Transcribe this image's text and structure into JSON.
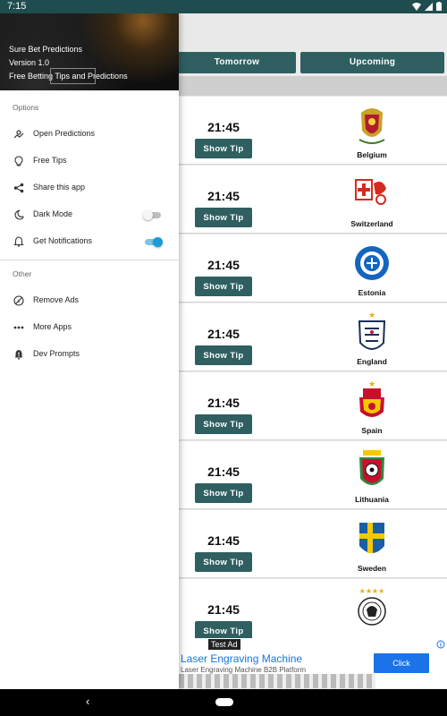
{
  "status_bar": {
    "time": "7:15"
  },
  "tabs": [
    {
      "label": "Tomorrow"
    },
    {
      "label": "Upcoming"
    }
  ],
  "matches": [
    {
      "time": "21:45",
      "tip_label": "Show Tip",
      "team": "Belgium"
    },
    {
      "time": "21:45",
      "tip_label": "Show Tip",
      "team": "Switzerland"
    },
    {
      "time": "21:45",
      "tip_label": "Show Tip",
      "team": "Estonia"
    },
    {
      "time": "21:45",
      "tip_label": "Show Tip",
      "team": "England"
    },
    {
      "time": "21:45",
      "tip_label": "Show Tip",
      "team": "Spain"
    },
    {
      "time": "21:45",
      "tip_label": "Show Tip",
      "team": "Lithuania"
    },
    {
      "time": "21:45",
      "tip_label": "Show Tip",
      "team": "Sweden"
    },
    {
      "time": "21:45",
      "tip_label": "Show Tip",
      "team": ""
    }
  ],
  "ad": {
    "label": "Test Ad",
    "title": "Laser Engraving Machine",
    "subtitle": "Laser Engraving Machine B2B Platform",
    "cta": "Click"
  },
  "drawer": {
    "header": {
      "app_name": "Sure Bet Predictions",
      "version": "Version 1.0",
      "tagline": "Free Betting Tips and Predictions"
    },
    "options_title": "Options",
    "options": [
      {
        "label": "Open Predictions",
        "icon": "predictions-icon"
      },
      {
        "label": "Free Tips",
        "icon": "lightbulb-icon"
      },
      {
        "label": "Share this app",
        "icon": "share-icon"
      },
      {
        "label": "Dark Mode",
        "icon": "moon-icon",
        "toggle": false
      },
      {
        "label": "Get Notifications",
        "icon": "bell-icon",
        "toggle": true
      }
    ],
    "other_title": "Other",
    "other": [
      {
        "label": "Remove Ads",
        "icon": "no-ads-icon"
      },
      {
        "label": "More Apps",
        "icon": "more-icon"
      },
      {
        "label": "Dev Prompts",
        "icon": "alert-bell-icon"
      }
    ]
  },
  "colors": {
    "primary": "#2f5f61",
    "status_bar": "#1f4d4f",
    "toggle_on": "#1a9ad8",
    "ad_button": "#1a73e8"
  }
}
